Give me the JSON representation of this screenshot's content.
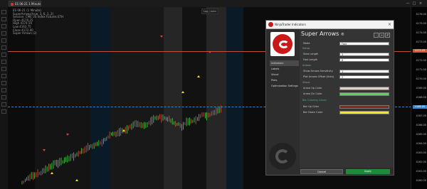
{
  "window": {
    "tab_label": "ES 06-21 1 Minute",
    "btn_min": "—",
    "btn_max": "□",
    "btn_close": "×"
  },
  "chart": {
    "legend_lines": [
      "ES 06-21 (1 Minute)",
      "SuperArrows(true, 3, 6, 1, 2)",
      "Session: CME US Index Futures ETH",
      "Open 4170.25",
      "High 4174.50",
      "Low 4163.75",
      "Close 4172.00",
      "Super Arrows (2)"
    ],
    "scale_label": "Log | Auto",
    "price_ticks": [
      "4176.00",
      "4175.00",
      "4174.00",
      "4173.00",
      "4172.00",
      "4171.00",
      "4170.00",
      "4169.00",
      "4168.00",
      "4167.00",
      "4166.00",
      "4165.00",
      "4164.00",
      "4163.00",
      "4162.00",
      "4161.00",
      "4160.00",
      "4159.00",
      "4158.00"
    ],
    "price_red_label": "4173.25",
    "price_blue_label": "4168.00",
    "colors": {
      "up": "#4bd64b",
      "down": "#e05050",
      "arrow_up": "#f5e625",
      "arrow_down": "#e04040",
      "red_line": "#d9533b",
      "blue_line": "#3d86c6"
    }
  },
  "dialog": {
    "header_title": "NinjaTrader Indicators",
    "close": "×",
    "title": "Super Arrows",
    "title_badge": "®",
    "nav": [
      "Indicators",
      "Labels",
      "Visual",
      "Plots",
      "Optimization Settings"
    ],
    "rows": [
      {
        "label": "Mode",
        "value": "Fast"
      },
      {
        "label": "Slow Length",
        "value": "3"
      },
      {
        "label": "Fast Length",
        "value": "6"
      },
      {
        "label": "Show Arrows Sensitivity",
        "value": "1"
      },
      {
        "label": "Plot Arrows Offset (ticks)",
        "value": "2"
      },
      {
        "label": "Arrow Up Color",
        "value": ""
      },
      {
        "label": "Arrow Dn Color",
        "value": ""
      },
      {
        "label": "Bar Up Color",
        "value": ""
      },
      {
        "label": "Bar Down Color",
        "value": ""
      }
    ],
    "sections": [
      "Setup",
      "Arrows",
      "Visual",
      "Bar Coloring Colors"
    ],
    "swatches": {
      "arrow_up": "#f4c7c7",
      "arrow_dn": "#5ad35a",
      "bar_up": "#9b1c1c",
      "bar_dn": "#f2ea1f"
    },
    "cancel": "Cancel",
    "ok": "Apply"
  }
}
